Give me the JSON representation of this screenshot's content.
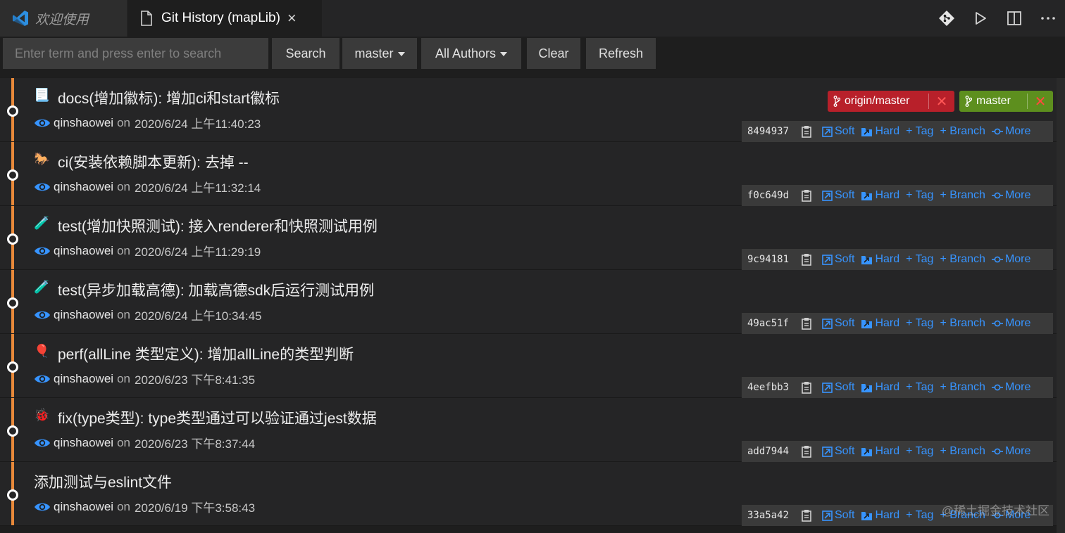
{
  "tabs": [
    {
      "label": "欢迎使用"
    },
    {
      "label": "Git History (mapLib)"
    }
  ],
  "toolbar": {
    "search_placeholder": "Enter term and press enter to search",
    "search_label": "Search",
    "branch_label": "master",
    "authors_label": "All Authors",
    "clear_label": "Clear",
    "refresh_label": "Refresh"
  },
  "labels": {
    "on": "on",
    "soft": "Soft",
    "hard": "Hard",
    "tag": "+ Tag",
    "branch": "+ Branch",
    "more": "More"
  },
  "refs": {
    "origin": "origin/master",
    "local": "master"
  },
  "commits": [
    {
      "emoji": "📃",
      "title": "docs(增加徽标): 增加ci和start徽标",
      "author": "qinshaowei",
      "date": "2020/6/24 上午11:40:23",
      "hash": "8494937"
    },
    {
      "emoji": "🐎",
      "title": "ci(安装依赖脚本更新): 去掉 --",
      "author": "qinshaowei",
      "date": "2020/6/24 上午11:32:14",
      "hash": "f0c649d"
    },
    {
      "emoji": "🧪",
      "title": "test(增加快照测试): 接入renderer和快照测试用例",
      "author": "qinshaowei",
      "date": "2020/6/24 上午11:29:19",
      "hash": "9c94181"
    },
    {
      "emoji": "🧪",
      "title": "test(异步加载高德): 加载高德sdk后运行测试用例",
      "author": "qinshaowei",
      "date": "2020/6/24 上午10:34:45",
      "hash": "49ac51f"
    },
    {
      "emoji": "🎈",
      "title": "perf(allLine 类型定义): 增加allLine的类型判断",
      "author": "qinshaowei",
      "date": "2020/6/23 下午8:41:35",
      "hash": "4eefbb3"
    },
    {
      "emoji": "🐞",
      "title": "fix(type类型): type类型通过可以验证通过jest数据",
      "author": "qinshaowei",
      "date": "2020/6/23 下午8:37:44",
      "hash": "add7944"
    },
    {
      "emoji": "",
      "title": "添加测试与eslint文件",
      "author": "qinshaowei",
      "date": "2020/6/19 下午3:58:43",
      "hash": "33a5a42"
    }
  ],
  "watermark": "@稀土掘金技术社区",
  "colors": {
    "graph": "#e8893a",
    "link": "#3794ff",
    "ref_red": "#b8202a",
    "ref_green": "#5d8f1e"
  }
}
